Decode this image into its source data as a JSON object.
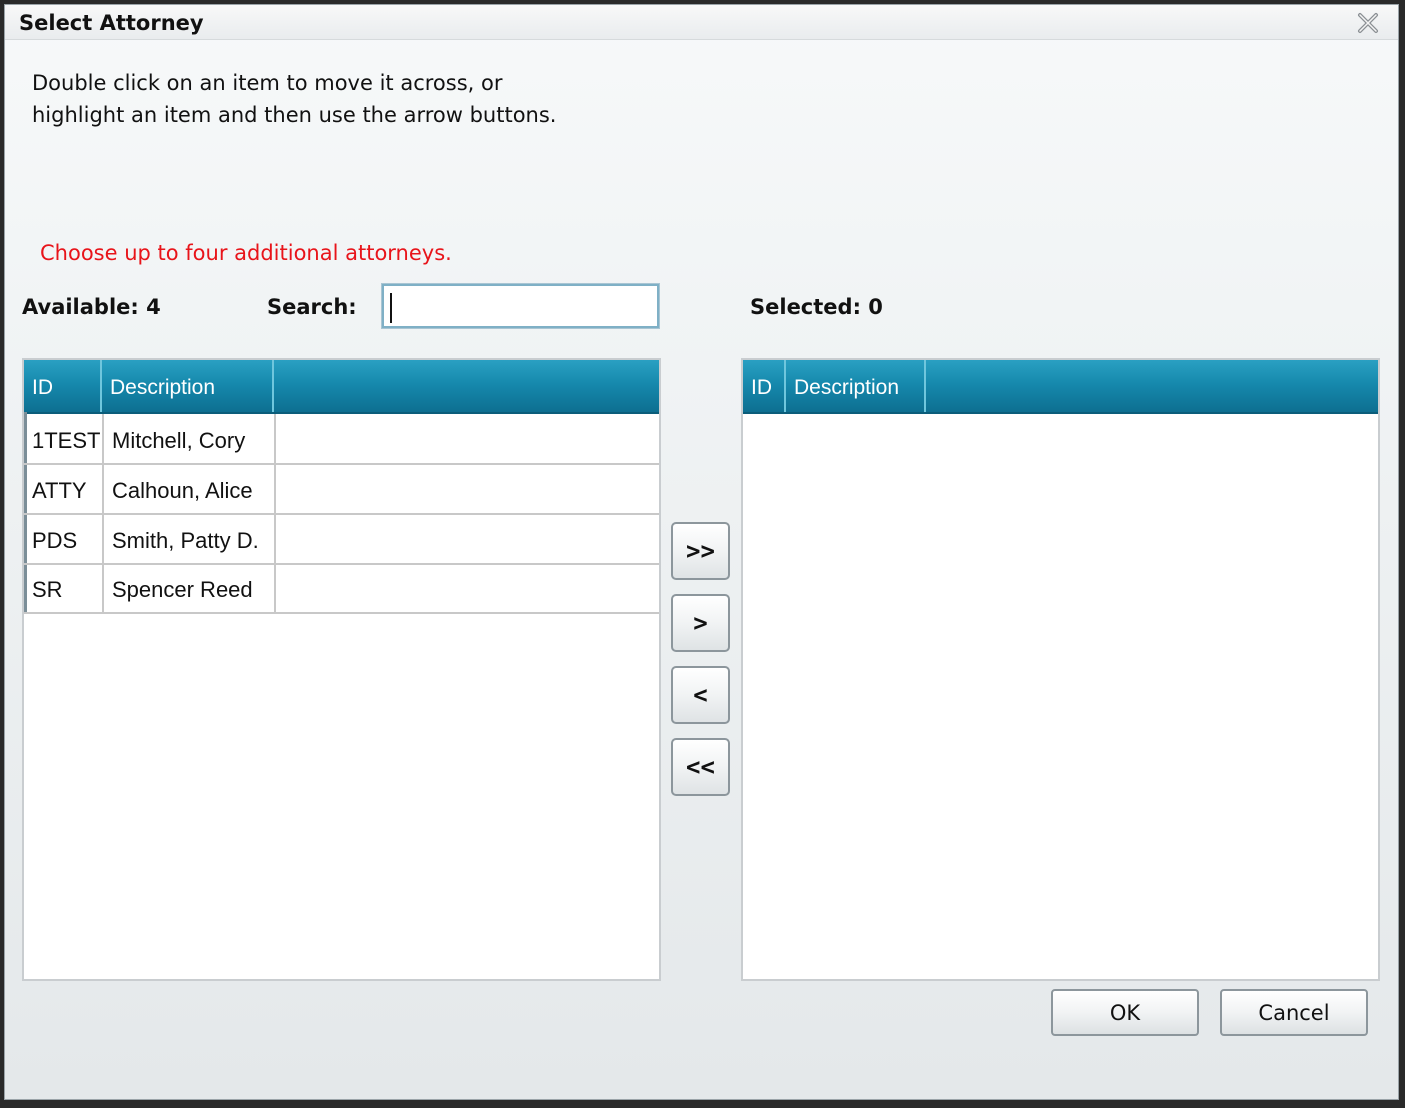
{
  "dialog": {
    "title": "Select Attorney",
    "close_icon": "close-icon"
  },
  "instructions": "Double click on an item to move it across, or\nhighlight an item and then use the arrow buttons.",
  "warning": "Choose up to four additional attorneys.",
  "warning_color": "#e8141a",
  "available_label": "Available: 4",
  "search_label": "Search:",
  "search": {
    "value": "",
    "placeholder": ""
  },
  "selected_label": "Selected: 0",
  "available_grid": {
    "columns": [
      "ID",
      "Description"
    ],
    "rows": [
      {
        "id": "1TEST",
        "description": "Mitchell, Cory"
      },
      {
        "id": "ATTY",
        "description": "Calhoun, Alice"
      },
      {
        "id": "PDS",
        "description": "Smith, Patty D."
      },
      {
        "id": "SR",
        "description": "Spencer Reed"
      }
    ]
  },
  "selected_grid": {
    "columns": [
      "ID",
      "Description"
    ],
    "rows": []
  },
  "transfer_buttons": {
    "move_all_right": ">>",
    "move_right": ">",
    "move_left": "<",
    "move_all_left": "<<"
  },
  "footer": {
    "ok_label": "OK",
    "cancel_label": "Cancel"
  },
  "header_color": "#1689ad"
}
